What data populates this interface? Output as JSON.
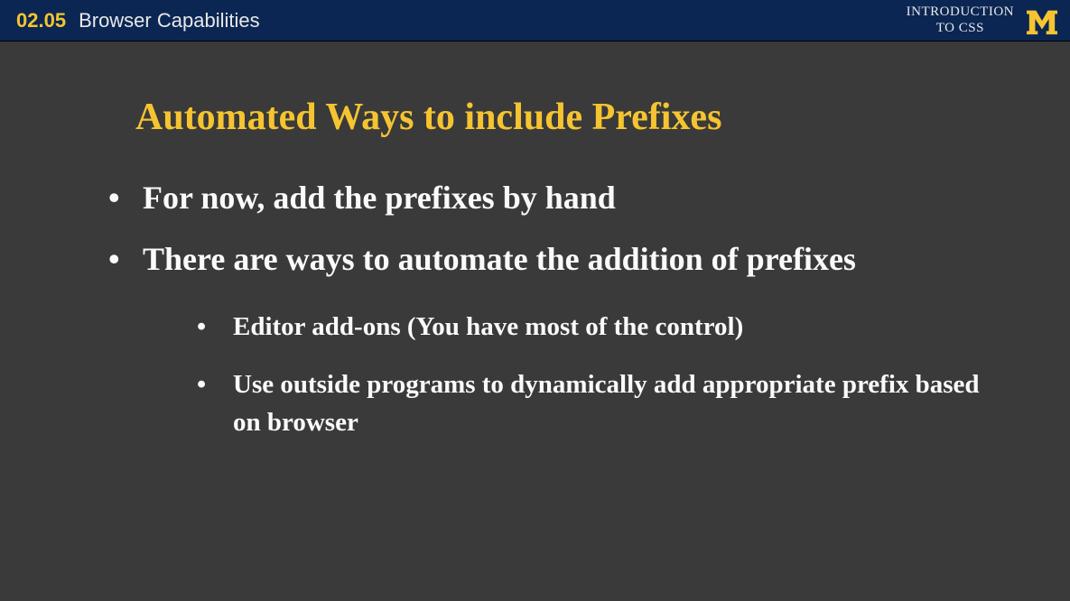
{
  "header": {
    "slide_number": "02.05",
    "slide_topic": "Browser Capabilities",
    "course_line1": "INTRODUCTION",
    "course_line2": "TO CSS"
  },
  "content": {
    "title": "Automated Ways to include Prefixes",
    "bullets": [
      "For now, add the prefixes by hand",
      "There are ways to automate the addition of prefixes"
    ],
    "sub_bullets": [
      "Editor add-ons (You have most of the control)",
      "Use outside programs to dynamically add appropriate prefix based on browser"
    ]
  }
}
